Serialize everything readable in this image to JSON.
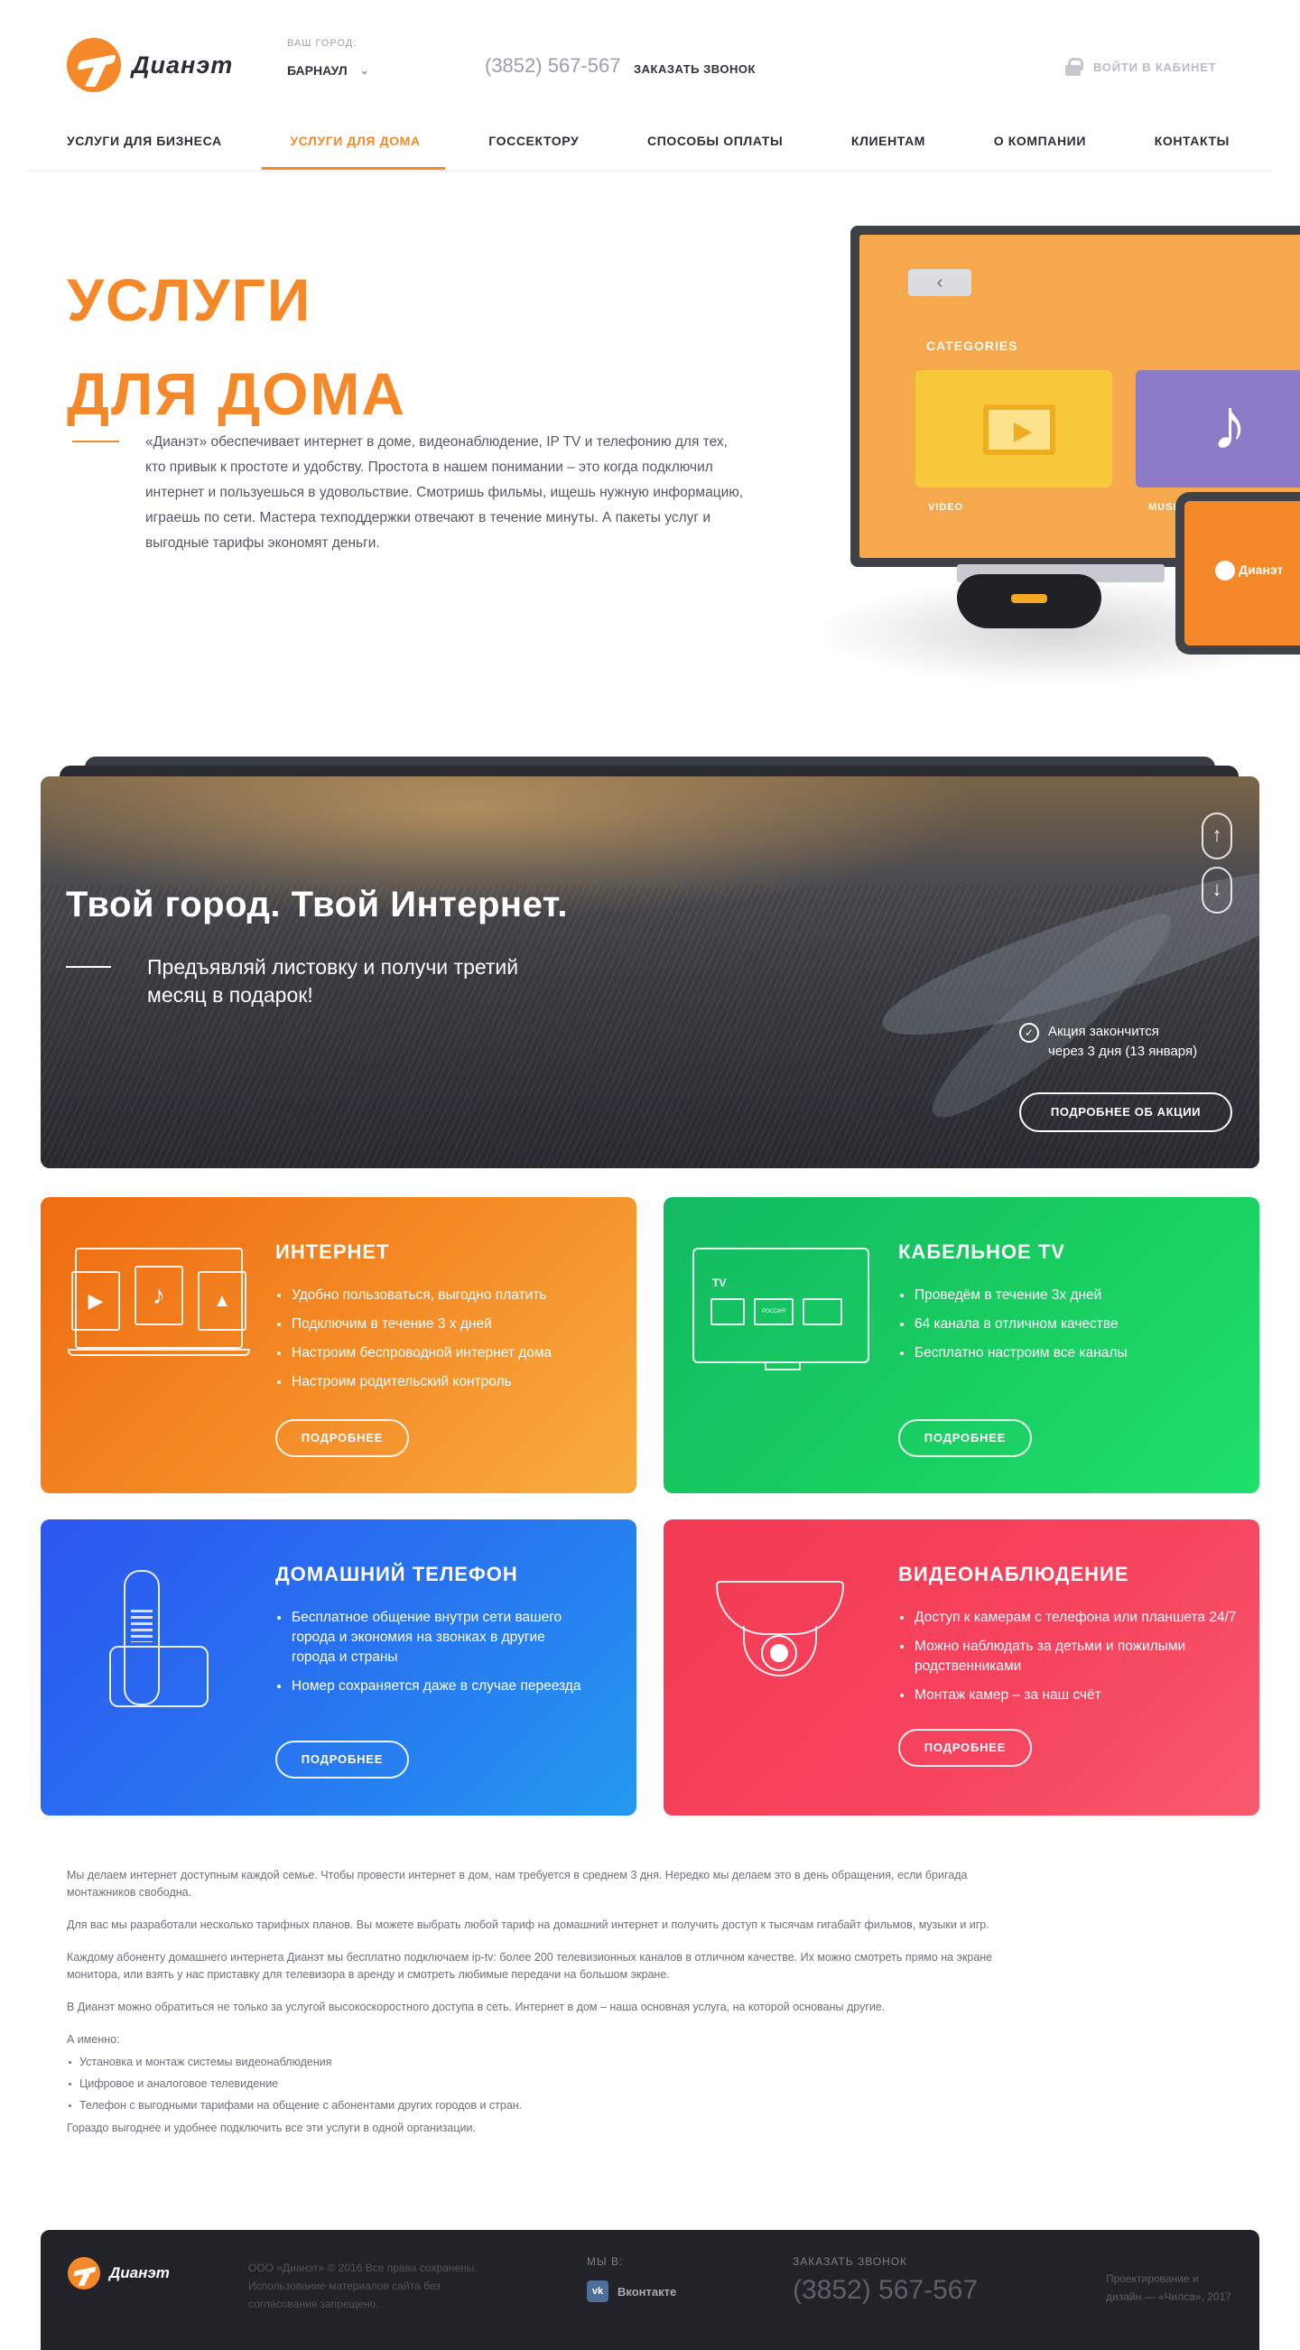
{
  "header": {
    "logo_text": "Дианэт",
    "city_label": "ВАШ ГОРОД:",
    "city_value": "БАРНАУЛ",
    "phone": "(3852) 567-567",
    "callback_label": "ЗАКАЗАТЬ ЗВОНОК",
    "login_label": "ВОЙТИ В КАБИНЕТ"
  },
  "nav": {
    "items": [
      {
        "label": "УСЛУГИ ДЛЯ БИЗНЕСА"
      },
      {
        "label": "УСЛУГИ ДЛЯ ДОМА",
        "active": true
      },
      {
        "label": "ГОССЕКТОРУ"
      },
      {
        "label": "СПОСОБЫ ОПЛАТЫ"
      },
      {
        "label": "КЛИЕНТАМ"
      },
      {
        "label": "О КОМПАНИИ"
      },
      {
        "label": "КОНТАКТЫ"
      }
    ]
  },
  "hero": {
    "title_line1": "УСЛУГИ",
    "title_line2": "ДЛЯ ДОМА",
    "text": "«Дианэт» обеспечивает интернет в доме, видеонаблюдение, IP TV и телефонию для тех, кто привык к простоте и удобству. Простота в нашем понимании – это когда подключил интернет и пользуешься в удовольствие. Смотришь фильмы, ищешь нужную информацию, играешь по сети. Мастера техподдержки отвечают в течение минуты. А пакеты услуг и выгодные тарифы экономят деньги.",
    "tv": {
      "categories_label": "CATEGORIES",
      "tile_video_label": "VIDEO",
      "tile_music_label": "MUSIC",
      "tablet_logo": "Дианэт"
    }
  },
  "banner": {
    "title": "Твой город. Твой Интернет.",
    "subtitle": "Предъявляй листовку и получи третий месяц в подарок!",
    "promo_end_line1": "Акция закончится",
    "promo_end_line2": "через 3 дня (13 января)",
    "button_label": "ПОДРОБНЕЕ ОБ АКЦИИ"
  },
  "cards": {
    "internet": {
      "title": "ИНТЕРНЕТ",
      "items": [
        "Удобно пользоваться, выгодно платить",
        "Подключим в течение 3 х дней",
        "Настроим беспроводной интернет дома",
        "Настроим родительский контроль"
      ],
      "button": "ПОДРОБНЕЕ"
    },
    "tv": {
      "title": "КАБЕЛЬНОЕ TV",
      "items": [
        "Проведём в течение 3х дней",
        "64 канала в отличном качестве",
        "Бесплатно настроим все каналы"
      ],
      "button": "ПОДРОБНЕЕ",
      "ill_label": "TV",
      "channel_label": "РОССИЯ"
    },
    "phone": {
      "title": "ДОМАШНИЙ ТЕЛЕФОН",
      "items": [
        "Бесплатное общение внутри сети вашего города и экономия на звонках в другие города и страны",
        "Номер сохраняется даже в случае переезда"
      ],
      "button": "ПОДРОБНЕЕ"
    },
    "cam": {
      "title": "ВИДЕОНАБЛЮДЕНИЕ",
      "items": [
        "Доступ к камерам с телефона или планшета 24/7",
        "Можно наблюдать за детьми и пожилыми родственниками",
        "Монтаж камер – за наш счёт"
      ],
      "button": "ПОДРОБНЕЕ"
    }
  },
  "seo": {
    "p1": "Мы делаем интернет доступным каждой семье. Чтобы провести интернет в дом, нам требуется в среднем 3 дня. Нередко мы делаем это в день обращения, если бригада монтажников свободна.",
    "p2": "Для вас мы разработали несколько тарифных планов. Вы можете выбрать любой тариф на домашний интернет и получить доступ к тысячам гигабайт фильмов, музыки и игр.",
    "p3": "Каждому абоненту домашнего интернета Дианэт мы бесплатно подключаем ip-tv: более 200 телевизионных каналов в отличном качестве. Их можно смотреть прямо на экране монитора, или взять у нас приставку для телевизора в аренду и смотреть любимые передачи на большом экране.",
    "p4": "В Дианэт можно обратиться не только за услугой высокоскоростного доступа в сеть. Интернет в дом – наша основная услуга, на которой основаны другие.",
    "p5": "А именно:",
    "list": [
      "Установка и монтаж системы видеонаблюдения",
      "Цифровое и аналоговое телевидение",
      "Телефон с выгодными тарифами на общение с абонентами других городов и стран."
    ],
    "p6": "Гораздо выгоднее и удобнее подключить все эти услуги в одной организации."
  },
  "footer": {
    "logo_text": "Дианэт",
    "copy": "ООО «Дианэт» © 2016 Все права сохранены. Использование материалов сайта без согласования запрещено.",
    "we_label": "МЫ В:",
    "vk_icon": "vk",
    "vk_label": "Вконтакте",
    "callback_label": "ЗАКАЗАТЬ ЗВОНОК",
    "phone": "(3852) 567-567",
    "design": "Проектирование и дизайн — «Чилса», 2017"
  },
  "colors": {
    "accent": "#f5892a",
    "internet": "#f48a25",
    "tv": "#18cc60",
    "phone": "#2873f0",
    "cam": "#f6445e",
    "footer": "#222329"
  }
}
